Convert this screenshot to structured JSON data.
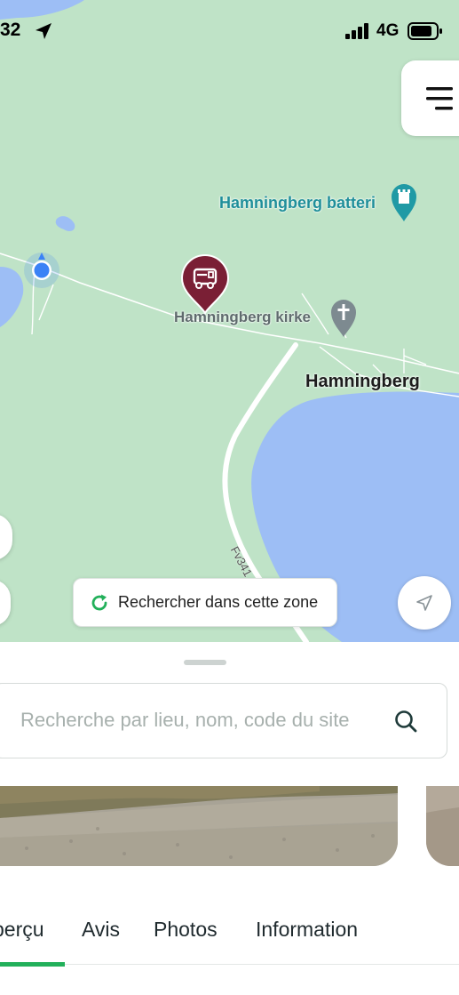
{
  "status_bar": {
    "time": "32",
    "network": "4G",
    "icons": [
      "location-arrow-icon",
      "signal-bars-icon",
      "battery-icon"
    ]
  },
  "map": {
    "labels": {
      "battery": "Hamningberg batteri",
      "church": "Hamningberg kirke",
      "town": "Hamningberg",
      "road": "Fv341"
    },
    "search_area_button": "Rechercher dans cette zone",
    "colors": {
      "land": "#bfe3c7",
      "water": "#9dbef5",
      "poi_pin": "#7a1f35",
      "user_location": "#3b82f6",
      "accent_green": "#22b05a",
      "battery_pin": "#1f9aa5"
    }
  },
  "sheet": {
    "search": {
      "placeholder": "Recherche par lieu, nom, code du site"
    },
    "tabs": [
      {
        "label": "perçu",
        "active": true
      },
      {
        "label": "Avis",
        "active": false
      },
      {
        "label": "Photos",
        "active": false
      },
      {
        "label": "Information",
        "active": false
      }
    ]
  }
}
